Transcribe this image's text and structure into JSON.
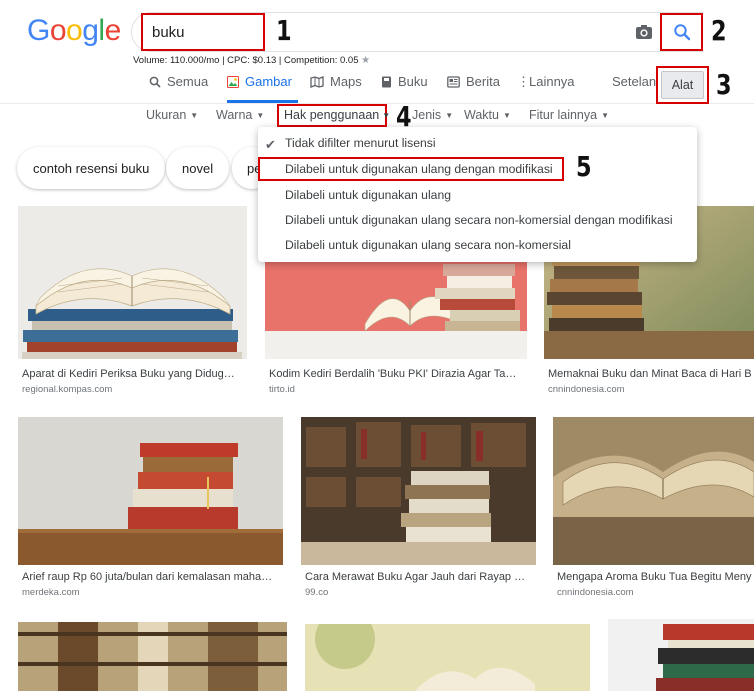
{
  "logo": [
    "G",
    "o",
    "o",
    "g",
    "l",
    "e"
  ],
  "logo_colors": [
    "#4285f4",
    "#ea4335",
    "#fbbc05",
    "#4285f4",
    "#34a853",
    "#ea4335"
  ],
  "search": {
    "value": "buku"
  },
  "callouts": [
    "1",
    "2",
    "3",
    "4",
    "5"
  ],
  "volume_text": "Volume: 110.000/mo | CPC: $0.13 | Competition: 0.05",
  "tabs": [
    "Semua",
    "Gambar",
    "Maps",
    "Buku",
    "Berita",
    "Lainnya"
  ],
  "settings_label": "Setelan",
  "tools_label": "Alat",
  "filters": [
    "Ukuran",
    "Warna",
    "Hak penggunaan",
    "Jenis",
    "Waktu",
    "Fitur lainnya"
  ],
  "license_options": [
    "Tidak difilter menurut lisensi",
    "Dilabeli untuk digunakan ulang dengan modifikasi",
    "Dilabeli untuk digunakan ulang",
    "Dilabeli untuk digunakan ulang secara non-komersial dengan modifikasi",
    "Dilabeli untuk digunakan ulang secara non-komersial"
  ],
  "chips": [
    "contoh resensi buku",
    "novel",
    "pe"
  ],
  "results": [
    {
      "caption": "Aparat di Kediri Periksa Buku yang Didug…",
      "source": "regional.kompas.com"
    },
    {
      "caption": "Kodim Kediri Berdalih 'Buku PKI' Dirazia Agar Ta…",
      "source": "tirto.id"
    },
    {
      "caption": "Memaknai Buku dan Minat Baca di Hari B",
      "source": "cnnindonesia.com"
    },
    {
      "caption": "Arief raup Rp 60 juta/bulan dari kemalasan maha…",
      "source": "merdeka.com"
    },
    {
      "caption": "Cara Merawat Buku Agar Jauh dari Rayap …",
      "source": "99.co"
    },
    {
      "caption": "Mengapa Aroma Buku Tua Begitu Meny",
      "source": "cnnindonesia.com"
    }
  ],
  "colors": {
    "accent": "#1a73e8",
    "highlight": "#d60000"
  },
  "icons": [
    "camera-icon",
    "search-icon",
    "check-icon"
  ]
}
